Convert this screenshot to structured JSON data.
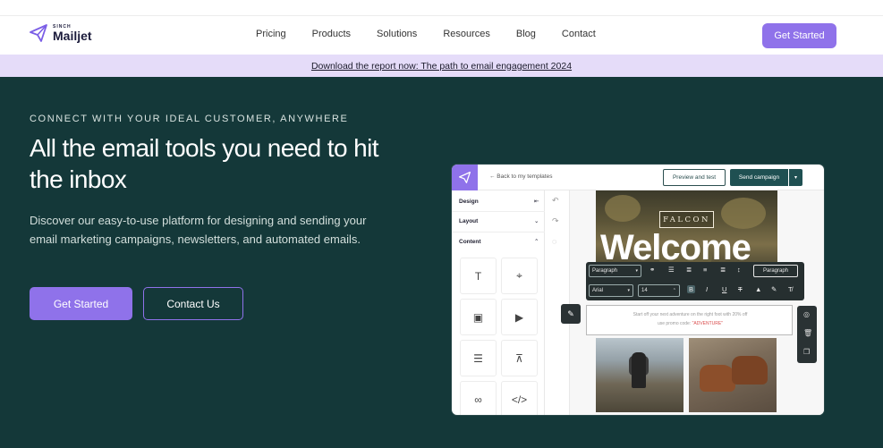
{
  "header": {
    "logo_small": "SINCH",
    "logo_main": "Mailjet",
    "nav": [
      "Pricing",
      "Products",
      "Solutions",
      "Resources",
      "Blog",
      "Contact"
    ],
    "cta": "Get Started"
  },
  "banner": {
    "text": "Download the report now: The path to email engagement 2024"
  },
  "hero": {
    "eyebrow": "CONNECT WITH YOUR IDEAL CUSTOMER, ANYWHERE",
    "headline": "All the email tools you need to hit the inbox",
    "subtext": "Discover our easy-to-use platform for designing and sending your email marketing campaigns, newsletters, and automated emails.",
    "primary_cta": "Get Started",
    "secondary_cta": "Contact Us"
  },
  "editor": {
    "back_label": "←  Back to my templates",
    "preview_label": "Preview and test",
    "send_label": "Send campaign",
    "sidebar": {
      "design": "Design",
      "layout": "Layout",
      "content": "Content"
    },
    "email": {
      "brand": "FALCON",
      "welcome": "Welcome",
      "body_line1": "Start off your next adventure on the right foot with 20% off",
      "body_line2_prefix": "use promo code: ",
      "promo_code": "\"ADVENTURE\""
    },
    "toolbar": {
      "style_select": "Paragraph",
      "font_select": "Arial",
      "size_select": "14",
      "block_type": "Paragraph"
    }
  },
  "colors": {
    "accent": "#8f72ea",
    "hero_bg": "#143839",
    "banner_bg": "#e5dcf9",
    "editor_primary": "#1f5052"
  }
}
